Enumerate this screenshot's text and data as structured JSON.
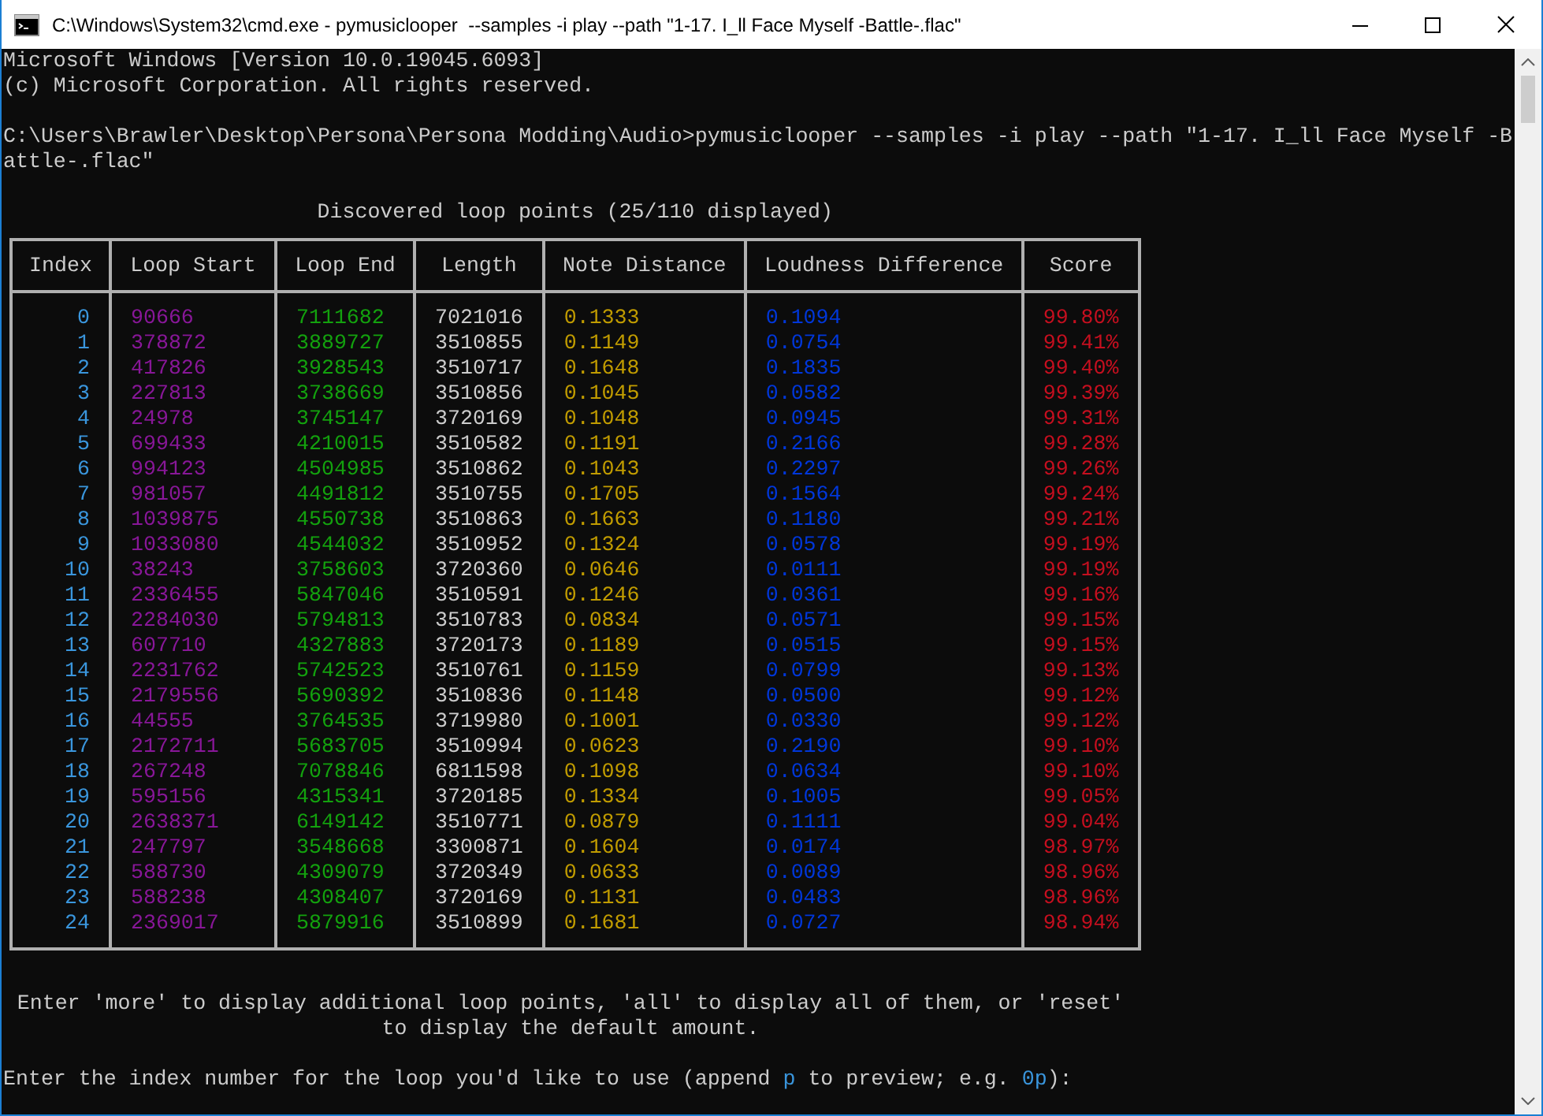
{
  "window": {
    "title": "C:\\Windows\\System32\\cmd.exe - pymusiclooper  --samples -i play --path \"1-17. I_ll Face Myself -Battle-.flac\""
  },
  "console": {
    "banner": [
      "Microsoft Windows [Version 10.0.19045.6093]",
      "(c) Microsoft Corporation. All rights reserved."
    ],
    "command": [
      "C:\\Users\\Brawler\\Desktop\\Persona\\Persona Modding\\Audio>pymusiclooper --samples -i play --path \"1-17. I_ll Face Myself -B",
      "attle-.flac\""
    ],
    "table_title": "Discovered loop points (25/110 displayed)",
    "table": {
      "columns": [
        {
          "label": "Index",
          "color": "#3a96dd"
        },
        {
          "label": "Loop Start",
          "color": "#881798"
        },
        {
          "label": "Loop End",
          "color": "#13a10e"
        },
        {
          "label": "Length",
          "color": "#cccccc"
        },
        {
          "label": "Note Distance",
          "color": "#c19c00"
        },
        {
          "label": "Loudness Difference",
          "color": "#0037da"
        },
        {
          "label": "Score",
          "color": "#c50f1f"
        }
      ],
      "rows": [
        [
          "0",
          "90666",
          "7111682",
          "7021016",
          "0.1333",
          "0.1094",
          "99.80%"
        ],
        [
          "1",
          "378872",
          "3889727",
          "3510855",
          "0.1149",
          "0.0754",
          "99.41%"
        ],
        [
          "2",
          "417826",
          "3928543",
          "3510717",
          "0.1648",
          "0.1835",
          "99.40%"
        ],
        [
          "3",
          "227813",
          "3738669",
          "3510856",
          "0.1045",
          "0.0582",
          "99.39%"
        ],
        [
          "4",
          "24978",
          "3745147",
          "3720169",
          "0.1048",
          "0.0945",
          "99.31%"
        ],
        [
          "5",
          "699433",
          "4210015",
          "3510582",
          "0.1191",
          "0.2166",
          "99.28%"
        ],
        [
          "6",
          "994123",
          "4504985",
          "3510862",
          "0.1043",
          "0.2297",
          "99.26%"
        ],
        [
          "7",
          "981057",
          "4491812",
          "3510755",
          "0.1705",
          "0.1564",
          "99.24%"
        ],
        [
          "8",
          "1039875",
          "4550738",
          "3510863",
          "0.1663",
          "0.1180",
          "99.21%"
        ],
        [
          "9",
          "1033080",
          "4544032",
          "3510952",
          "0.1324",
          "0.0578",
          "99.19%"
        ],
        [
          "10",
          "38243",
          "3758603",
          "3720360",
          "0.0646",
          "0.0111",
          "99.19%"
        ],
        [
          "11",
          "2336455",
          "5847046",
          "3510591",
          "0.1246",
          "0.0361",
          "99.16%"
        ],
        [
          "12",
          "2284030",
          "5794813",
          "3510783",
          "0.0834",
          "0.0571",
          "99.15%"
        ],
        [
          "13",
          "607710",
          "4327883",
          "3720173",
          "0.1189",
          "0.0515",
          "99.15%"
        ],
        [
          "14",
          "2231762",
          "5742523",
          "3510761",
          "0.1159",
          "0.0799",
          "99.13%"
        ],
        [
          "15",
          "2179556",
          "5690392",
          "3510836",
          "0.1148",
          "0.0500",
          "99.12%"
        ],
        [
          "16",
          "44555",
          "3764535",
          "3719980",
          "0.1001",
          "0.0330",
          "99.12%"
        ],
        [
          "17",
          "2172711",
          "5683705",
          "3510994",
          "0.0623",
          "0.2190",
          "99.10%"
        ],
        [
          "18",
          "267248",
          "7078846",
          "6811598",
          "0.1098",
          "0.0634",
          "99.10%"
        ],
        [
          "19",
          "595156",
          "4315341",
          "3720185",
          "0.1334",
          "0.1005",
          "99.05%"
        ],
        [
          "20",
          "2638371",
          "6149142",
          "3510771",
          "0.0879",
          "0.1111",
          "99.04%"
        ],
        [
          "21",
          "247797",
          "3548668",
          "3300871",
          "0.1604",
          "0.0174",
          "98.97%"
        ],
        [
          "22",
          "588730",
          "4309079",
          "3720349",
          "0.0633",
          "0.0089",
          "98.96%"
        ],
        [
          "23",
          "588238",
          "4308407",
          "3720169",
          "0.1131",
          "0.0483",
          "98.96%"
        ],
        [
          "24",
          "2369017",
          "5879916",
          "3510899",
          "0.1681",
          "0.0727",
          "98.94%"
        ]
      ]
    },
    "hint": [
      "Enter 'more' to display additional loop points, 'all' to display all of them, or 'reset'",
      "to display the default amount."
    ],
    "prompt": [
      {
        "text": "Enter the index number for the loop you'd like to use (append ",
        "highlight": false
      },
      {
        "text": "p",
        "highlight": true
      },
      {
        "text": " to preview; e.g. ",
        "highlight": false
      },
      {
        "text": "0p",
        "highlight": true
      },
      {
        "text": "):",
        "highlight": false
      }
    ]
  }
}
